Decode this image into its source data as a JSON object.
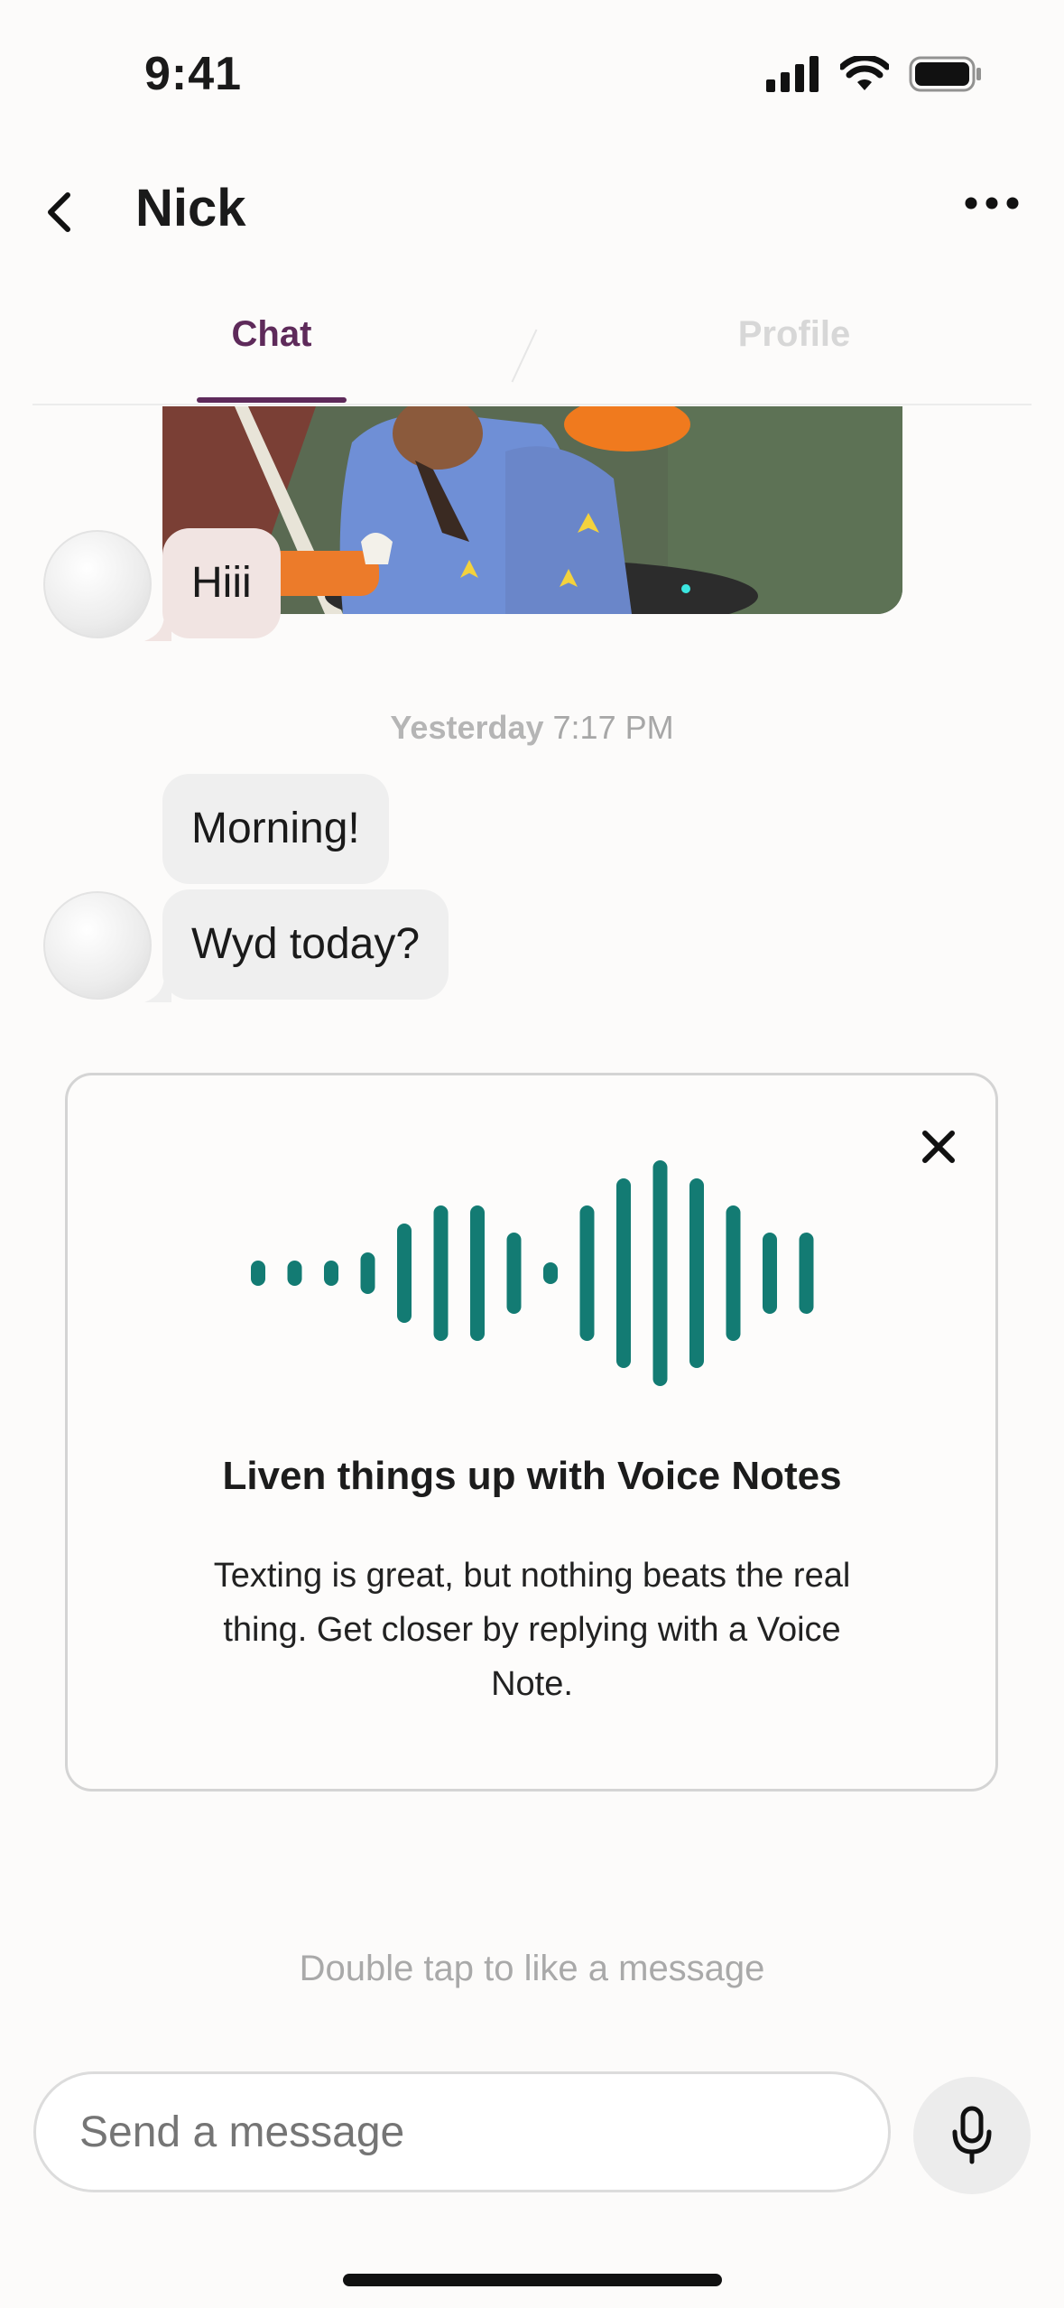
{
  "status_bar": {
    "time": "9:41"
  },
  "header": {
    "title": "Nick"
  },
  "tabs": [
    {
      "label": "Chat",
      "active": true
    },
    {
      "label": "Profile",
      "active": false
    }
  ],
  "messages": [
    {
      "text": "Hiii",
      "style": "pink"
    },
    {
      "text": "Morning!",
      "style": "grey"
    },
    {
      "text": "Wyd today?",
      "style": "grey"
    }
  ],
  "timestamp": {
    "day": "Yesterday",
    "time": "7:17 PM"
  },
  "voice_card": {
    "title": "Liven things up with Voice Notes",
    "body": "Texting is great, but nothing beats the real thing. Get closer by replying with a Voice Note.",
    "accent": "#137b73"
  },
  "hint": "Double tap to like a message",
  "composer": {
    "placeholder": "Send a message"
  },
  "colors": {
    "tab_active": "#5e2a5a",
    "tab_inactive": "#d7d7d7"
  }
}
